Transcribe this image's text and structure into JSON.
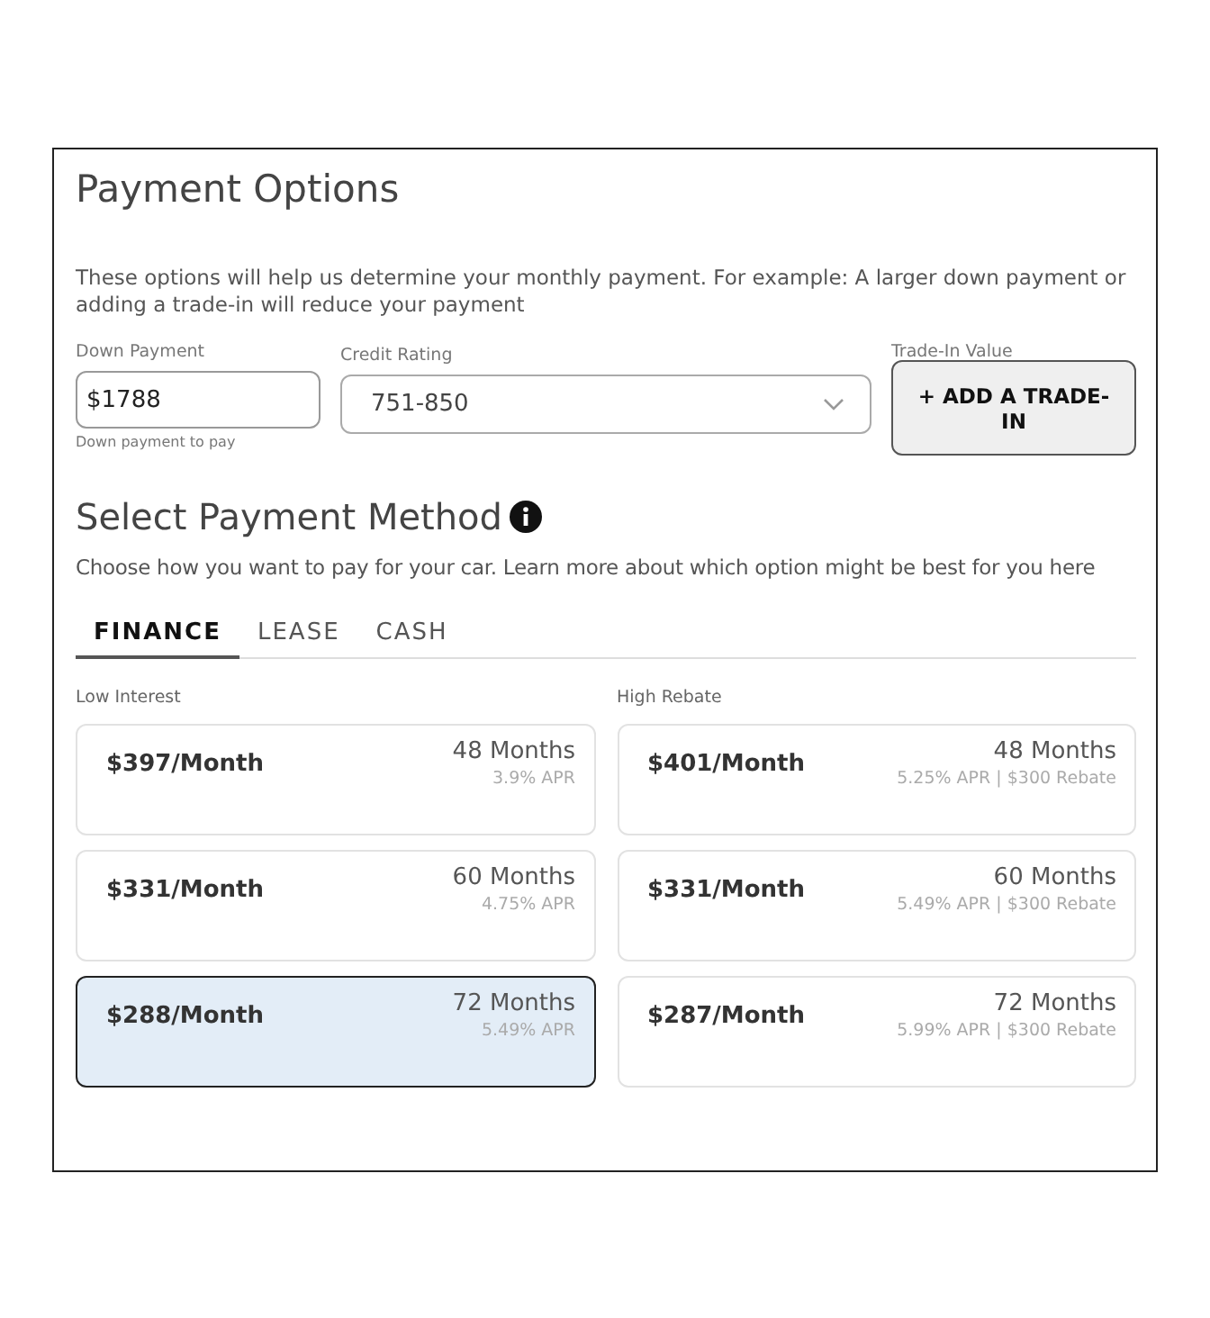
{
  "title": "Payment Options",
  "intro": "These options will help us determine your monthly payment. For example: A larger down payment or adding a trade-in will reduce your payment",
  "down_payment": {
    "label": "Down Payment",
    "value": "$1788",
    "hint": "Down payment to pay"
  },
  "credit_rating": {
    "label": "Credit Rating",
    "value": "751-850"
  },
  "trade_in": {
    "label": "Trade-In Value",
    "button": "+ ADD A TRADE-IN"
  },
  "method_title": "Select Payment Method",
  "method_text": "Choose how you want to pay for your car. Learn more about which option might be best for you here",
  "tabs": [
    {
      "label": "FINANCE",
      "selected": true
    },
    {
      "label": "LEASE",
      "selected": false
    },
    {
      "label": "CASH",
      "selected": false
    }
  ],
  "groups": [
    {
      "label": "Low Interest",
      "options": [
        {
          "price": "$397/Month",
          "term": "48 Months",
          "detail": "3.9% APR",
          "selected": false
        },
        {
          "price": "$331/Month",
          "term": "60 Months",
          "detail": "4.75% APR",
          "selected": false
        },
        {
          "price": "$288/Month",
          "term": "72 Months",
          "detail": "5.49% APR",
          "selected": true
        }
      ]
    },
    {
      "label": "High Rebate",
      "options": [
        {
          "price": "$401/Month",
          "term": "48 Months",
          "detail": "5.25% APR | $300 Rebate",
          "selected": false
        },
        {
          "price": "$331/Month",
          "term": "60 Months",
          "detail": "5.49% APR | $300 Rebate",
          "selected": false
        },
        {
          "price": "$287/Month",
          "term": "72 Months",
          "detail": "5.99% APR | $300 Rebate",
          "selected": false
        }
      ]
    }
  ]
}
